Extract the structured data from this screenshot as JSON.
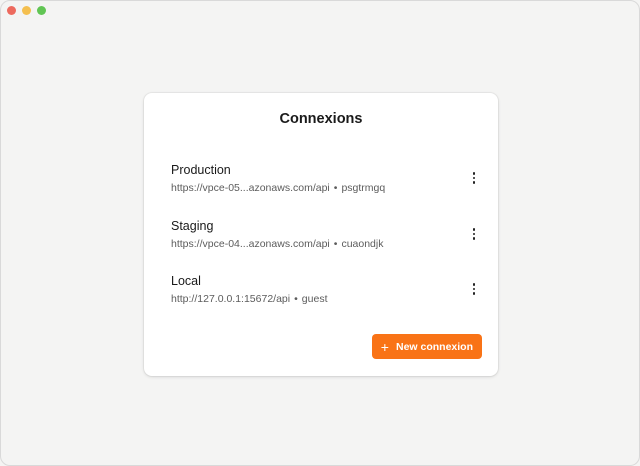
{
  "window": {
    "controls": [
      {
        "name": "close",
        "color": "#ed6a5e"
      },
      {
        "name": "minimize",
        "color": "#f4bf4f"
      },
      {
        "name": "maximize",
        "color": "#61c554"
      }
    ]
  },
  "card": {
    "title": "Connexions",
    "connections": [
      {
        "name": "Production",
        "url": "https://vpce-05...azonaws.com/api",
        "separator": "•",
        "user": "psgtrmgq"
      },
      {
        "name": "Staging",
        "url": "https://vpce-04...azonaws.com/api",
        "separator": "•",
        "user": "cuaondjk"
      },
      {
        "name": "Local",
        "url": "http://127.0.0.1:15672/api",
        "separator": "•",
        "user": "guest"
      }
    ],
    "new_button": {
      "icon": "+",
      "label": "New connexion"
    },
    "accent_color": "#f97316"
  }
}
